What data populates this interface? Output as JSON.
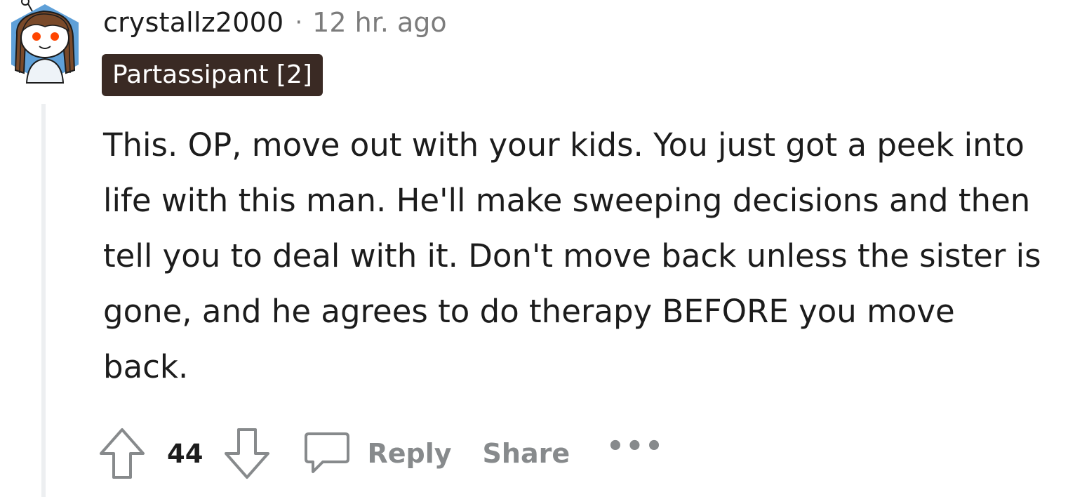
{
  "comment": {
    "username": "crystallz2000",
    "separator": "·",
    "timestamp": "12 hr. ago",
    "flair": "Partassipant [2]",
    "body": "This. OP, move out with your kids. You just got a peek into life with this man. He'll make sweeping decisions and then tell you to deal with it. Don't move back unless the sister is gone, and he agrees to do therapy BEFORE you move back.",
    "avatar_icon": "snoo-avatar-icon",
    "flair_color": "#3a2a24"
  },
  "actions": {
    "upvote_icon": "upvote-arrow-icon",
    "vote_count": "44",
    "downvote_icon": "downvote-arrow-icon",
    "reply_icon": "comment-bubble-icon",
    "reply_label": "Reply",
    "share_label": "Share",
    "more_label": "•••"
  }
}
